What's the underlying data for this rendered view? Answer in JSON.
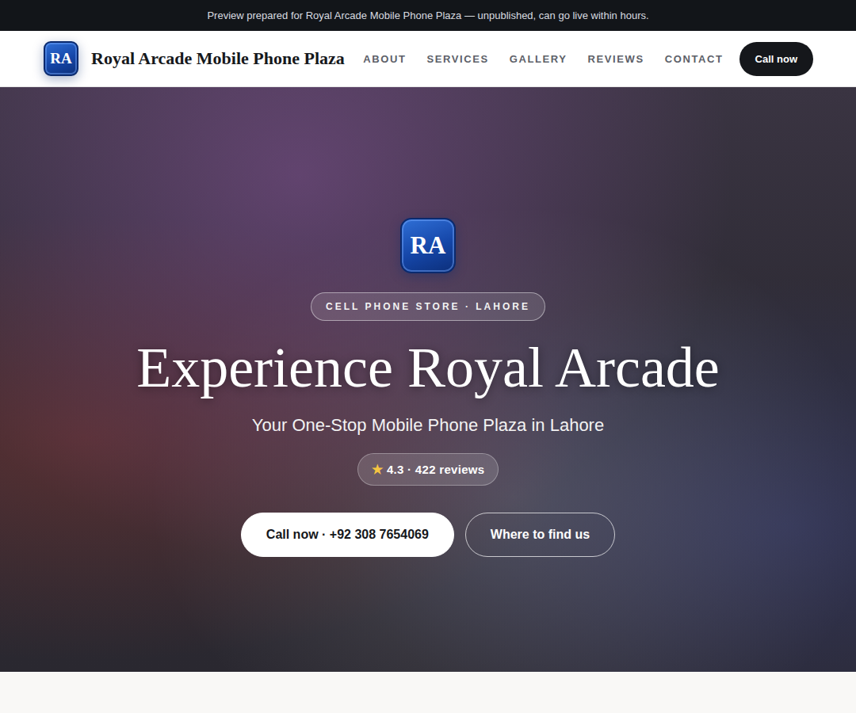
{
  "banner": {
    "text": "Preview prepared for Royal Arcade Mobile Phone Plaza — unpublished, can go live within hours."
  },
  "brand": {
    "initials": "RA",
    "name": "Royal Arcade Mobile Phone Plaza"
  },
  "nav": {
    "items": [
      "ABOUT",
      "SERVICES",
      "GALLERY",
      "REVIEWS",
      "CONTACT"
    ],
    "cta": "Call now"
  },
  "hero": {
    "initials": "RA",
    "badge": "CELL PHONE STORE · LAHORE",
    "title": "Experience Royal Arcade",
    "subtitle": "Your One-Stop Mobile Phone Plaza in Lahore",
    "rating": {
      "star": "★",
      "text": "4.3 · 422 reviews"
    },
    "buttons": [
      {
        "label": "Call now · +92 308 7654069",
        "kind": "solid"
      },
      {
        "label": "Where to find us",
        "kind": "outline"
      }
    ]
  }
}
